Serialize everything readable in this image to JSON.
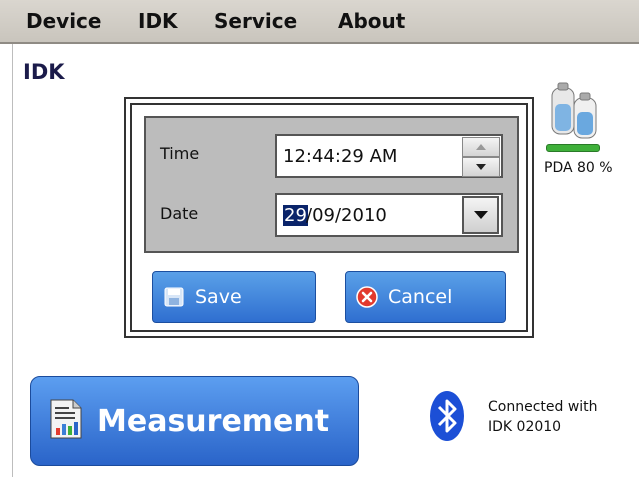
{
  "menu": {
    "items": [
      "Device",
      "IDK",
      "Service",
      "About"
    ]
  },
  "page": {
    "title": "IDK"
  },
  "dialog": {
    "time_label": "Time",
    "time_value": "12:44:29 AM",
    "date_label": "Date",
    "date_day": "29",
    "date_rest": "/09/2010",
    "save_label": "Save",
    "cancel_label": "Cancel"
  },
  "battery": {
    "label": "PDA 80 %",
    "level_percent": 80
  },
  "measurement": {
    "label": "Measurement"
  },
  "connection": {
    "line1": "Connected with",
    "line2": "IDK 02010",
    "icon": "bluetooth-icon"
  },
  "colors": {
    "button_blue": "#2f6fd0",
    "selection": "#0a246a",
    "battery_green": "#3fb03a"
  }
}
